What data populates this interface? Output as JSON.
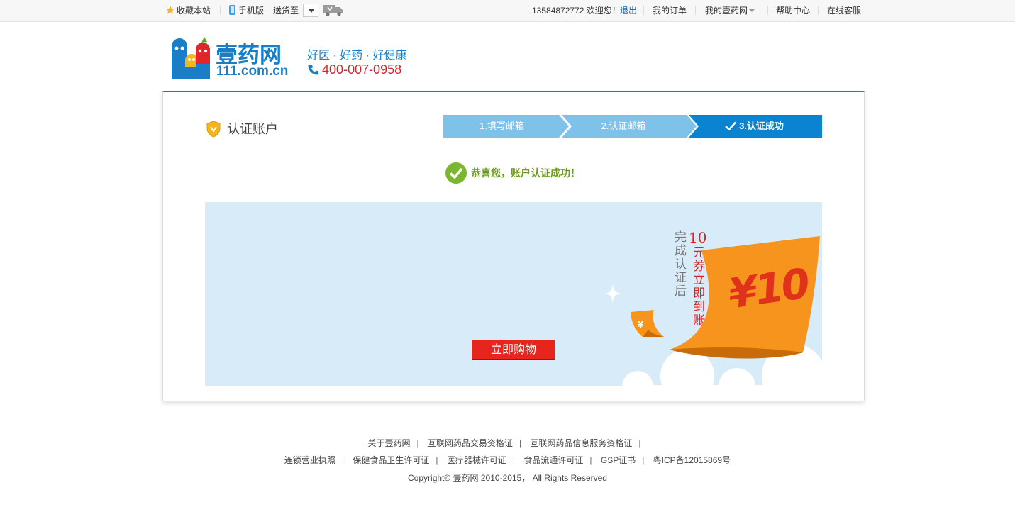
{
  "topbar": {
    "favorite": "收藏本站",
    "mobile": "手机版",
    "ship_to": "送货至",
    "user_greeting": "13584872772 欢迎您！",
    "logout": "退出",
    "my_orders": "我的订单",
    "my_account": "我的壹药网",
    "help": "帮助中心",
    "service": "在线客服"
  },
  "header": {
    "logo_text": "壹药网",
    "logo_domain": "111.com.cn",
    "slogan": "好医 · 好药 · 好健康",
    "hotline": "400-007-0958"
  },
  "card": {
    "title": "认证账户",
    "steps": [
      {
        "label": "1.填写邮箱",
        "active": false
      },
      {
        "label": "2.认证邮箱",
        "active": false
      },
      {
        "label": "3.认证成功",
        "active": true
      }
    ],
    "success_message": "恭喜您，账户认证成功！"
  },
  "banner": {
    "left_vertical": "完成认证后",
    "amount_num": "10",
    "right_vertical": "元券立即到账",
    "coupon_text": "¥10",
    "small_coin": "¥",
    "button": "立即购物"
  },
  "footer": {
    "row1": [
      "关于壹药网",
      "互联网药品交易资格证",
      "互联网药品信息服务资格证",
      ""
    ],
    "row2": [
      "连锁营业执照",
      "保健食品卫生许可证",
      "医疗器械许可证",
      "食品流通许可证",
      "GSP证书",
      "粤ICP备12015869号"
    ],
    "copyright": "Copyright© 壹药网 2010-2015， All Rights Reserved"
  },
  "colors": {
    "brand_blue": "#1a7ec6",
    "step_active": "#0a83d0",
    "step_inactive": "#7ec2ea",
    "success_green": "#6b9b1e",
    "button_red": "#e8251d",
    "coupon_orange": "#f7941d"
  }
}
